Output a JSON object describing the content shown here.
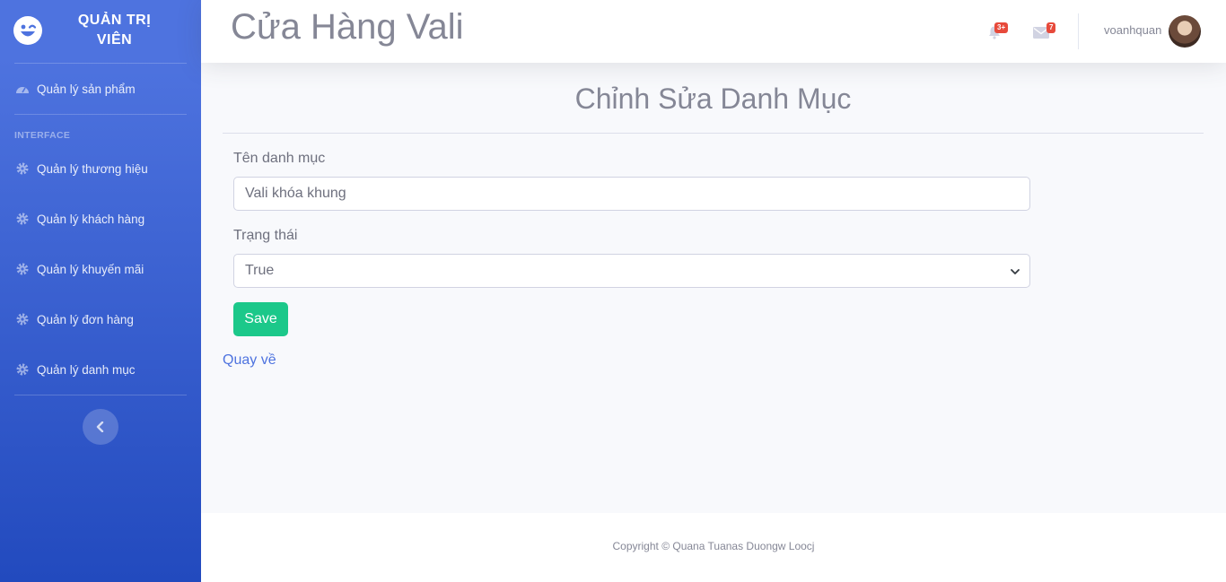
{
  "sidebar": {
    "brand_text": "QUẢN TRỊ VIÊN",
    "dashboard_label": "Quản lý sản phẩm",
    "section_heading": "INTERFACE",
    "items": [
      {
        "label": "Quản lý thương hiệu",
        "icon": "gear-icon"
      },
      {
        "label": "Quản lý khách hàng",
        "icon": "gear-icon"
      },
      {
        "label": "Quản lý khuyến mãi",
        "icon": "gear-icon"
      },
      {
        "label": "Quản lý đơn hàng",
        "icon": "gear-icon"
      },
      {
        "label": "Quản lý danh mục",
        "icon": "gear-icon"
      }
    ]
  },
  "topbar": {
    "title": "Cửa Hàng Vali",
    "alerts_badge": "3+",
    "messages_badge": "7",
    "username": "voanhquan"
  },
  "form": {
    "heading": "Chỉnh Sửa Danh Mục",
    "name_label": "Tên danh mục",
    "name_value": "Vali khóa khung",
    "status_label": "Trạng thái",
    "status_value": "True",
    "save_label": "Save",
    "back_label": "Quay về"
  },
  "footer": {
    "copyright": "Copyright © Quana Tuanas Duongw Loocj"
  },
  "colors": {
    "primary": "#4e73df",
    "success": "#1cc88a",
    "danger": "#e74a3b"
  }
}
